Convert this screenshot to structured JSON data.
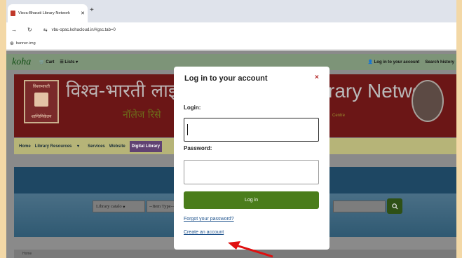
{
  "browser": {
    "tab_title": "Visva-Bharati Library Network",
    "tab_close": "✕",
    "new_tab": "+",
    "url": "vbu-opac.kohacloud.in/#gsc.tab=0",
    "bookmark": "banner-img"
  },
  "koha_nav": {
    "logo": "koha",
    "cart": "Cart",
    "lists": "Lists",
    "login": "Log in to your account",
    "search_history": "Search history"
  },
  "banner": {
    "seal_top": "विश्वभारती",
    "seal_bottom": "शान्तिनिकेतन",
    "hindi_title": "विश्व-भारती लाइब्रेरी",
    "hindi_subtitle": "नॉलेज रिसे",
    "english_title": "rary Network",
    "centre": "Centre"
  },
  "main_nav": {
    "home": "Home",
    "library_resources": "Library Resources",
    "services": "Services",
    "website": "Website",
    "digital_library": "Digital Library"
  },
  "search": {
    "catalog_select": "Library catalo",
    "type_select": "--Item Type--"
  },
  "breadcrumb": "Home",
  "modal": {
    "title": "Log in to your account",
    "close": "×",
    "login_label": "Login:",
    "password_label": "Password:",
    "login_button": "Log in",
    "forgot_password": "Forgot your password?",
    "create_account": "Create an account"
  },
  "colors": {
    "accent_green": "#4a7d1b",
    "annotation_arrow": "#e01010",
    "outer_background": "#f3d8a6"
  }
}
